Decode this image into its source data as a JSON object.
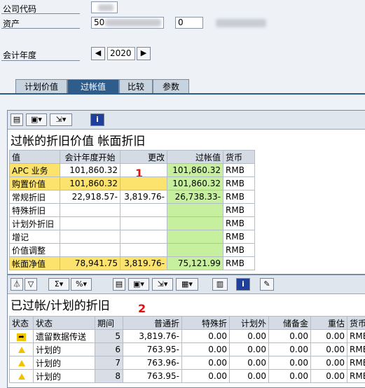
{
  "header": {
    "company_code_label": "公司代码",
    "asset_label": "资产",
    "asset_main_value": "50",
    "asset_sub_value": "0",
    "fiscal_year_label": "会计年度",
    "fiscal_year_value": "2020"
  },
  "tabs": [
    {
      "label": "计划价值"
    },
    {
      "label": "过帐值"
    },
    {
      "label": "比较"
    },
    {
      "label": "参数"
    }
  ],
  "section1": {
    "title": "过帐的折旧价值 帐面折旧",
    "marker": "1",
    "columns": [
      "值",
      "会计年度开始",
      "更改",
      "过帐值",
      "货币"
    ],
    "rows": [
      [
        "APC 业务",
        "101,860.32",
        "",
        "101,860.32",
        "RMB"
      ],
      [
        "购置价值",
        "101,860.32",
        "",
        "101,860.32",
        "RMB"
      ],
      [
        "常规折旧",
        "22,918.57-",
        "3,819.76-",
        "26,738.33-",
        "RMB"
      ],
      [
        "特殊折旧",
        "",
        "",
        "",
        "RMB"
      ],
      [
        "计划外折旧",
        "",
        "",
        "",
        "RMB"
      ],
      [
        "增记",
        "",
        "",
        "",
        "RMB"
      ],
      [
        "价值调整",
        "",
        "",
        "",
        "RMB"
      ],
      [
        "帐面净值",
        "78,941.75",
        "3,819.76-",
        "75,121.99",
        "RMB"
      ]
    ]
  },
  "section2": {
    "title": "已过帐/计划的折旧",
    "marker": "2",
    "columns": [
      "状态",
      "状态",
      "期间",
      "普通折",
      "特殊折",
      "计划外",
      "储备金",
      "重估",
      "货币"
    ],
    "rows": [
      [
        "遗留数据传送",
        "5",
        "3,819.76-",
        "0.00",
        "0.00",
        "0.00",
        "0.00",
        "RMB"
      ],
      [
        "计划的",
        "6",
        "763.95-",
        "0.00",
        "0.00",
        "0.00",
        "0.00",
        "RMB"
      ],
      [
        "计划的",
        "7",
        "763.96-",
        "0.00",
        "0.00",
        "0.00",
        "0.00",
        "RMB"
      ],
      [
        "计划的",
        "8",
        "763.95-",
        "0.00",
        "0.00",
        "0.00",
        "0.00",
        "RMB"
      ]
    ]
  }
}
